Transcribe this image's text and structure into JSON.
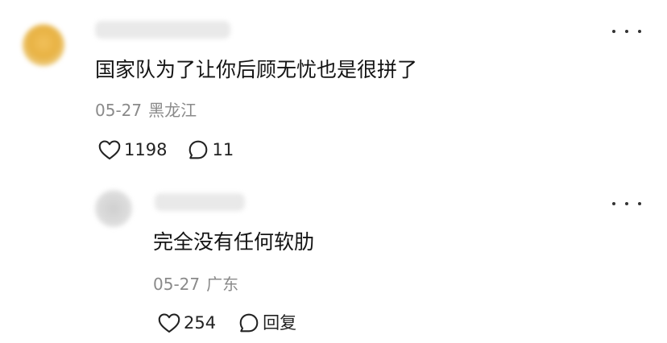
{
  "comments": [
    {
      "avatar_icon": "blurred-avatar",
      "text": "国家队为了让你后顾无忧也是很拼了",
      "date": "05-27",
      "location": "黑龙江",
      "likes": "1198",
      "replies": "11",
      "more_icon": "more-dots-icon"
    },
    {
      "avatar_icon": "blurred-avatar",
      "text": "完全没有任何软肋",
      "date": "05-27",
      "location": "广东",
      "likes": "254",
      "reply_label": "回复",
      "more_icon": "more-dots-icon"
    }
  ],
  "icons": {
    "like": "heart-outline-icon",
    "comment": "speech-bubble-icon"
  },
  "colors": {
    "text": "#141414",
    "meta": "#8a8a8a",
    "icon": "#222222",
    "background": "#ffffff"
  }
}
